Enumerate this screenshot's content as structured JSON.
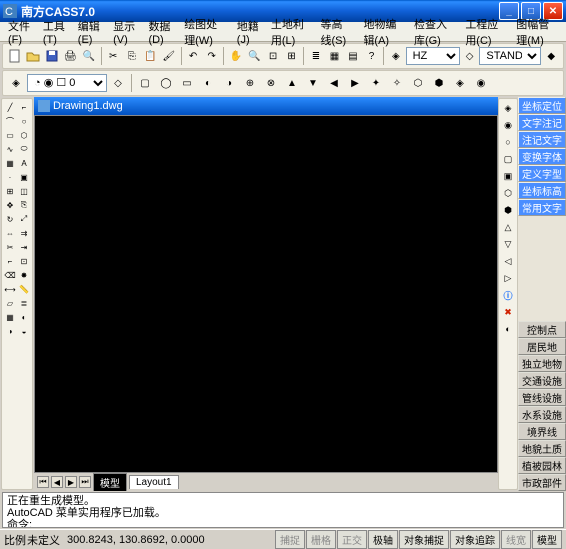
{
  "title": "南方CASS7.0",
  "menus": [
    "文件(F)",
    "工具(T)",
    "编辑(E)",
    "显示(V)",
    "数据(D)",
    "绘图处理(W)",
    "地籍(J)",
    "土地利用(L)",
    "等高线(S)",
    "地物编辑(A)",
    "检查入库(G)",
    "工程应用(C)",
    "图幅管理(M)"
  ],
  "layer_sel": "HZ",
  "style_sel": "STANDARD",
  "doc_title": "Drawing1.dwg",
  "tabs": {
    "model": "模型",
    "layout": "Layout1"
  },
  "right_blue": [
    "坐标定位",
    "文字注记",
    "注记文字",
    "变换字体",
    "定义字型",
    "坐标标高",
    "常用文字"
  ],
  "right_gray": [
    "控制点",
    "居民地",
    "独立地物",
    "交通设施",
    "管线设施",
    "水系设施",
    "境界线",
    "地貌土质",
    "植被园林",
    "市政部件"
  ],
  "cmd": {
    "l1": "正在重生成模型。",
    "l2": "AutoCAD 菜单实用程序已加载。",
    "l3": "命令:"
  },
  "status": {
    "label": "比例",
    "undef": "未定义",
    "coords": "300.8243, 130.8692, 0.0000",
    "btns": [
      "捕捉",
      "栅格",
      "正交",
      "极轴",
      "对象捕捉",
      "对象追踪",
      "线宽",
      "模型"
    ]
  }
}
